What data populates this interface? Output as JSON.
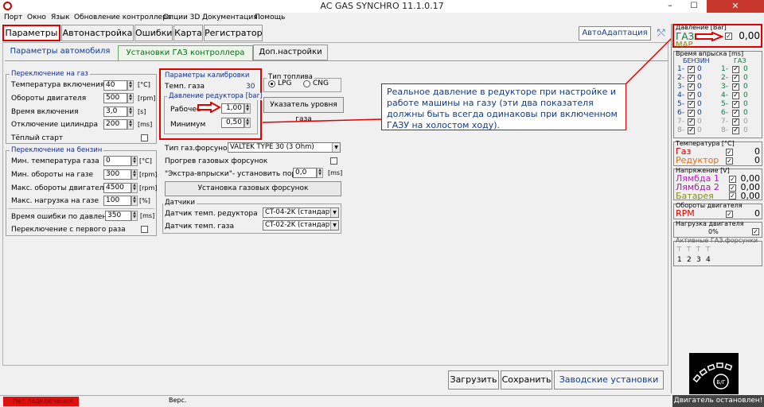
{
  "window": {
    "title": "AC GAS SYNCHRO  11.1.0.17",
    "minimize": "–",
    "maximize": "☐",
    "close": "✕"
  },
  "menu": [
    "Порт",
    "Окно",
    "Язык",
    "Обновление контроллера",
    "Опции 3D",
    "Документация",
    "Помощь"
  ],
  "main_tabs": [
    "Параметры",
    "Автонастройка",
    "Ошибки",
    "Карта",
    "Регистратор"
  ],
  "autoadapt_button": "АвтоАдаптация",
  "sub_tabs": [
    "Параметры автомобиля",
    "Установки ГАЗ контроллера",
    "Доп.настройки"
  ],
  "switch_to_gas": {
    "title": "Переключение на газ",
    "rows": [
      {
        "label": "Температура включения",
        "value": "40",
        "unit": "[°C]"
      },
      {
        "label": "Обороты двигателя",
        "value": "500",
        "unit": "[rpm]"
      },
      {
        "label": "Время включения",
        "value": "3,0",
        "unit": "[s]"
      },
      {
        "label": "Отключение цилиндра",
        "value": "200",
        "unit": "[ms]"
      }
    ],
    "warm_start": "Тёплый старт"
  },
  "switch_to_petrol": {
    "title": "Переключение на бензин",
    "rows": [
      {
        "label": "Мин. температура газа",
        "value": "0",
        "unit": "[°C]"
      },
      {
        "label": "Мин. обороты на газе",
        "value": "300",
        "unit": "[rpm]"
      },
      {
        "label": "Макс. обороты двигателя",
        "value": "4500",
        "unit": "[rpm]"
      },
      {
        "label": "Макс. нагрузка на газе",
        "value": "100",
        "unit": "[%]"
      }
    ],
    "pressure_error_time": {
      "label": "Время ошибки по давлению",
      "value": "350",
      "unit": "[ms]"
    },
    "first_gear": "Переключение с первого раза"
  },
  "calibration": {
    "title": "Параметры калибровки",
    "gas_temp_label": "Темп. газа",
    "gas_temp_value": "30",
    "pressure_title": "Давление редуктора [bar]",
    "working_label": "Рабочее",
    "working_value": "1,00",
    "minimum_label": "Минимум",
    "minimum_value": "0,50"
  },
  "fuel_type": {
    "title": "Тип топлива",
    "lpg": "LPG",
    "cng": "CNG"
  },
  "level_indicator_button": "Указатель уровня газа",
  "injectors": {
    "type_label": "Тип газ.форсунок",
    "type_value": "VALTEK TYPE 30 (3 Ohm)",
    "warmup_label": "Прогрев газовых форсунок",
    "extra_label": "\"Экстра-впрыски\"- установить порог",
    "extra_value": "0,0",
    "extra_unit": "[ms]",
    "install_button": "Установка газовых форсунок"
  },
  "sensors": {
    "title": "Датчики",
    "reducer_label": "Датчик темп. редуктора",
    "reducer_value": "CT-04-2K (стандарт",
    "gas_label": "Датчик темп. газа",
    "gas_value": "CT-02-2K (стандарт"
  },
  "note": "Реальное давление в редукторе при настройке и работе машины на газу (эти два показателя должны быть всегда одинаковы при включенном ГАЗУ на холостом ходу).",
  "right_panel": {
    "pressure": {
      "title": "Давление [Bar]",
      "gas": "ГАЗ",
      "gas_value": "0,00",
      "map": "MAP"
    },
    "injection": {
      "title": "Время впрыска [ms]",
      "petrol": "БЕНЗИН",
      "gas": "ГАЗ",
      "rows": [
        "1-",
        "2-",
        "3-",
        "4-",
        "5-",
        "6-",
        "7-",
        "8-"
      ]
    },
    "temperature": {
      "title": "Температура [°C]",
      "gas": "Газ",
      "gas_value": "0",
      "reducer": "Редуктор",
      "reducer_value": "0"
    },
    "voltage": {
      "title": "Напряжение [V]",
      "lambda1": "Лямбда 1",
      "lambda1_value": "0,00",
      "lambda2": "Лямбда 2",
      "lambda2_value": "0,00",
      "battery": "Батарея",
      "battery_value": "0,00"
    },
    "rpm": {
      "title": "Обороты двигателя",
      "label": "RPM",
      "value": "0"
    },
    "load": {
      "title": "Нагрузка двигателя",
      "value": "0%"
    },
    "active_injectors": {
      "title": "Активные ГАЗ.форсунки",
      "numbers": [
        "1",
        "2",
        "3",
        "4"
      ]
    },
    "logo_text": "Б/Г"
  },
  "bottom_buttons": [
    "Загрузить",
    "Сохранить",
    "Заводские установки"
  ],
  "status": {
    "connection": "Нет подключения",
    "version": "Верс.",
    "engine": "Двигатель остановлен!"
  },
  "colors": {
    "highlight": "#e00000",
    "brand_blue": "#123a8a",
    "green_active": "#0a6a1a",
    "status_red": "#e01010"
  }
}
